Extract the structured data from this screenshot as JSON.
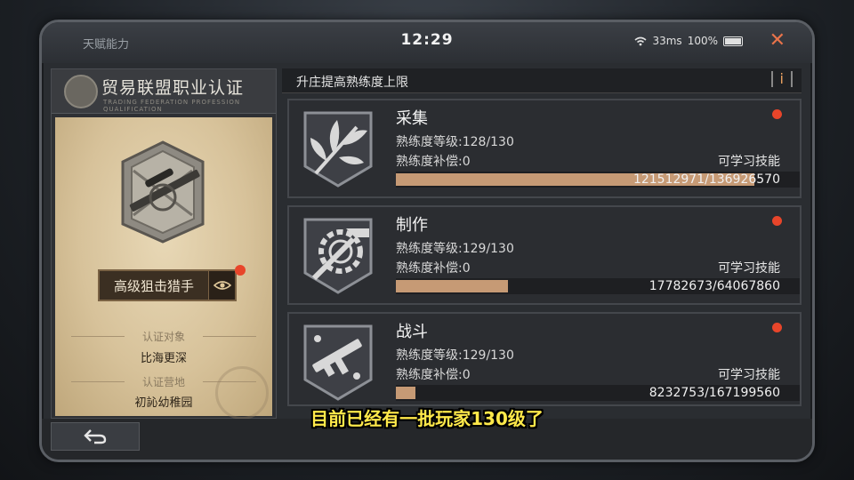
{
  "topbar": {
    "left_title": "天赋能力",
    "clock": "12:29",
    "ping": "33ms",
    "battery": "100%",
    "close_icon": "close-icon",
    "accent": "#e8734a"
  },
  "cert": {
    "title": "贸易联盟职业认证",
    "subtitle": "TRADING FEDERATION PROFESSION QUALIFICATION",
    "rank": "高级狙击猎手",
    "target_label": "认证对象",
    "target_value": "比海更深",
    "base_label": "认证营地",
    "base_value": "初訫幼稚园"
  },
  "panel": {
    "section_title": "升庄提高熟练度上限",
    "info_label": "i"
  },
  "skills": [
    {
      "name": "采集",
      "level": "熟练度等级:128/130",
      "comp": "熟练度补偿:0",
      "learn": "可学习技能",
      "progress_text": "121512971/136926570",
      "progress": 0.887
    },
    {
      "name": "制作",
      "level": "熟练度等级:129/130",
      "comp": "熟练度补偿:0",
      "learn": "可学习技能",
      "progress_text": "17782673/64067860",
      "progress": 0.278
    },
    {
      "name": "战斗",
      "level": "熟练度等级:129/130",
      "comp": "熟练度补偿:0",
      "learn": "可学习技能",
      "progress_text": "8232753/167199560",
      "progress": 0.049
    }
  ],
  "caption": "目前已经有一批玩家130级了",
  "colors": {
    "progress_fill": "#c69a75",
    "notification_dot": "#e8452a",
    "caption": "#ffe94a"
  }
}
